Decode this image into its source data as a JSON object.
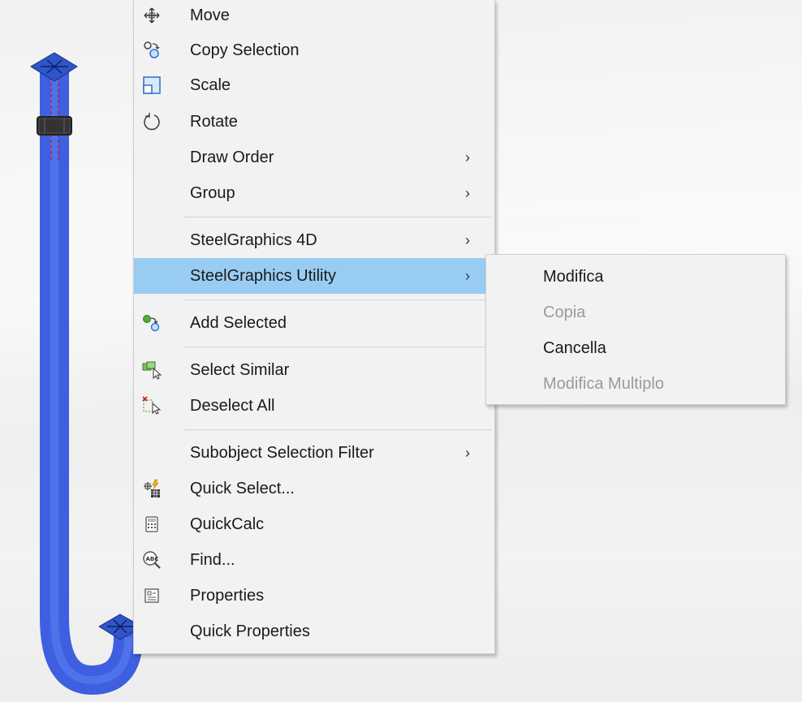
{
  "context_menu": {
    "items": [
      {
        "label": "Move",
        "icon": "move-icon",
        "submenu": false
      },
      {
        "label": "Copy Selection",
        "icon": "copy-selection-icon",
        "submenu": false
      },
      {
        "label": "Scale",
        "icon": "scale-icon",
        "submenu": false
      },
      {
        "label": "Rotate",
        "icon": "rotate-icon",
        "submenu": false
      },
      {
        "label": "Draw Order",
        "icon": "",
        "submenu": true
      },
      {
        "label": "Group",
        "icon": "",
        "submenu": true
      },
      {
        "label": "SteelGraphics 4D",
        "icon": "",
        "submenu": true
      },
      {
        "label": "SteelGraphics Utility",
        "icon": "",
        "submenu": true,
        "highlighted": true
      },
      {
        "label": "Add Selected",
        "icon": "add-selected-icon",
        "submenu": false
      },
      {
        "label": "Select Similar",
        "icon": "select-similar-icon",
        "submenu": false
      },
      {
        "label": "Deselect All",
        "icon": "deselect-all-icon",
        "submenu": false
      },
      {
        "label": "Subobject Selection Filter",
        "icon": "",
        "submenu": true
      },
      {
        "label": "Quick Select...",
        "icon": "quick-select-icon",
        "submenu": false
      },
      {
        "label": "QuickCalc",
        "icon": "calculator-icon",
        "submenu": false
      },
      {
        "label": "Find...",
        "icon": "find-text-icon",
        "submenu": false
      },
      {
        "label": "Properties",
        "icon": "properties-icon",
        "submenu": false
      },
      {
        "label": "Quick Properties",
        "icon": "",
        "submenu": false
      }
    ],
    "arrow_glyph": "›"
  },
  "submenu": {
    "items": [
      {
        "label": "Modifica",
        "enabled": true
      },
      {
        "label": "Copia",
        "enabled": false
      },
      {
        "label": "Cancella",
        "enabled": true
      },
      {
        "label": "Modifica Multiplo",
        "enabled": false
      }
    ]
  },
  "colors": {
    "highlight": "#99ccf2",
    "pipe": "#3d5fe0",
    "menu_bg": "#f2f2f2",
    "disabled_text": "#9a9a9a"
  }
}
